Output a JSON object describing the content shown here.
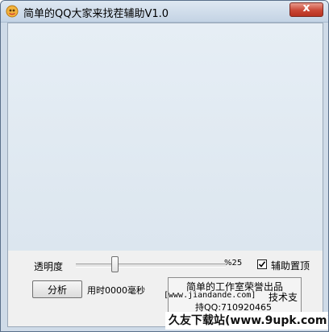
{
  "window": {
    "title": "简单的QQ大家来找茬辅助V1.0",
    "close_label": "x"
  },
  "controls": {
    "opacity_label": "透明度",
    "opacity_percent_text": "%25",
    "opacity_value": 0.25,
    "assist_topmost_label": "辅助置顶",
    "assist_topmost_checked": true,
    "analyze_label": "分析",
    "elapsed_text": "用时0000毫秒"
  },
  "credits": {
    "line1": "简单的工作室荣誉出品",
    "url": "[www.jiandande.com]",
    "support": "技术支",
    "qq": "持QQ:710920465"
  },
  "watermark": {
    "text": "久友下载站(www.9upk.com)"
  },
  "colors": {
    "client_bg": "#f0f0f0",
    "canvas_bg": "#e6eef5",
    "close_red": "#c94735"
  },
  "icons": {
    "app": "qq-app-icon",
    "check": "checkmark-icon"
  }
}
